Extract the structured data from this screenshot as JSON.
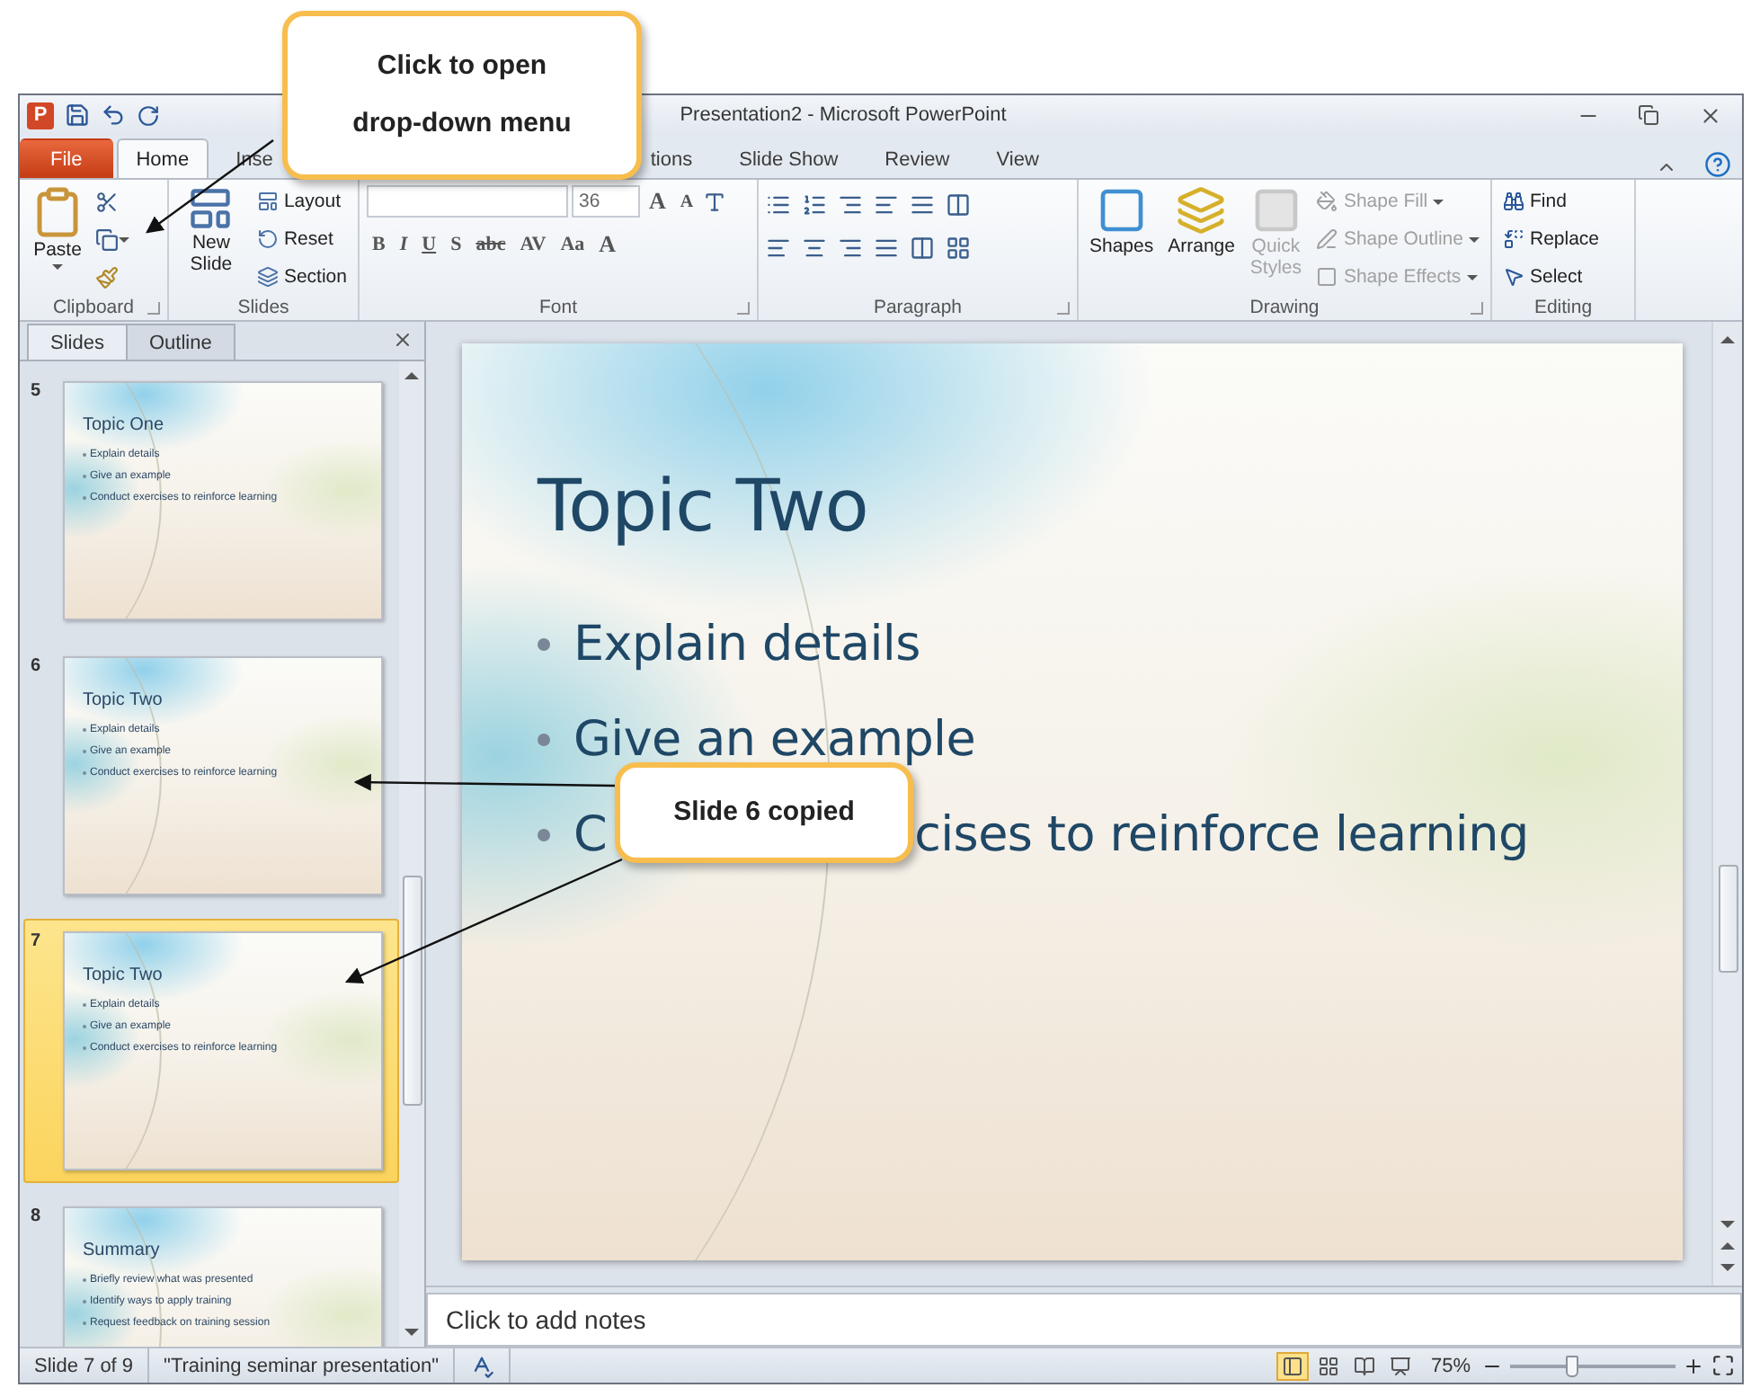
{
  "window": {
    "app_letter": "P",
    "title": "Presentation2 - Microsoft PowerPoint"
  },
  "tabs": [
    {
      "label": "File",
      "kind": "file",
      "selected": false
    },
    {
      "label": "Home",
      "kind": "tab",
      "selected": true
    },
    {
      "label": "Inse",
      "kind": "cut_right",
      "selected": false
    },
    {
      "label": "tions",
      "kind": "cut_left",
      "selected": false
    },
    {
      "label": "Slide Show",
      "kind": "tab",
      "selected": false
    },
    {
      "label": "Review",
      "kind": "tab",
      "selected": false
    },
    {
      "label": "View",
      "kind": "tab",
      "selected": false
    }
  ],
  "ribbon": {
    "clipboard": {
      "label": "Clipboard",
      "paste": "Paste"
    },
    "slides": {
      "label": "Slides",
      "new_slide": "New Slide",
      "items": [
        "Layout",
        "Reset",
        "Section"
      ]
    },
    "font": {
      "label": "Font",
      "size": "36",
      "size_buttons": [
        "A",
        "A"
      ],
      "format_buttons": [
        "B",
        "I",
        "U",
        "S",
        "abc",
        "AV",
        "Aa"
      ],
      "color_button": "A"
    },
    "paragraph": {
      "label": "Paragraph"
    },
    "drawing": {
      "label": "Drawing",
      "big": [
        {
          "label": "Shapes",
          "disabled": false
        },
        {
          "label": "Arrange",
          "disabled": false
        },
        {
          "label": "Quick Styles",
          "disabled": true
        }
      ],
      "small": [
        {
          "label": "Shape Fill",
          "disabled": true
        },
        {
          "label": "Shape Outline",
          "disabled": true
        },
        {
          "label": "Shape Effects",
          "disabled": true
        }
      ]
    },
    "editing": {
      "label": "Editing",
      "items": [
        "Find",
        "Replace",
        "Select"
      ]
    }
  },
  "slides_panel": {
    "tabs": [
      {
        "label": "Slides",
        "selected": true
      },
      {
        "label": "Outline",
        "selected": false
      }
    ],
    "thumbnails": [
      {
        "number": "5",
        "title": "Topic One",
        "bullets": [
          "Explain details",
          "Give an example",
          "Conduct exercises to reinforce learning"
        ],
        "selected": false
      },
      {
        "number": "6",
        "title": "Topic Two",
        "bullets": [
          "Explain details",
          "Give an example",
          "Conduct exercises to reinforce learning"
        ],
        "selected": false
      },
      {
        "number": "7",
        "title": "Topic Two",
        "bullets": [
          "Explain details",
          "Give an example",
          "Conduct exercises to reinforce learning"
        ],
        "selected": true
      },
      {
        "number": "8",
        "title": "Summary",
        "bullets": [
          "Briefly review what was presented",
          "Identify ways to apply training",
          "Request feedback on training session"
        ],
        "selected": false
      }
    ]
  },
  "slide": {
    "title": "Topic Two",
    "bullets": [
      {
        "parts": [
          "Explain details"
        ]
      },
      {
        "parts": [
          "Give an example"
        ]
      },
      {
        "parts": [
          "C",
          "cises to reinforce learning"
        ]
      }
    ]
  },
  "notes": {
    "placeholder": "Click to add notes"
  },
  "status_bar": {
    "slide": "Slide 7 of 9",
    "theme": "\"Training seminar presentation\"",
    "views": [
      {
        "kind": "normal",
        "selected": true
      },
      {
        "kind": "sorter",
        "selected": false
      },
      {
        "kind": "reading",
        "selected": false
      },
      {
        "kind": "show",
        "selected": false
      }
    ],
    "zoom": "75%",
    "zoom_slider": {
      "level": 0.37
    }
  },
  "callouts": [
    {
      "text": "Click to open drop-down menu"
    },
    {
      "text": "Slide 6 copied"
    }
  ]
}
